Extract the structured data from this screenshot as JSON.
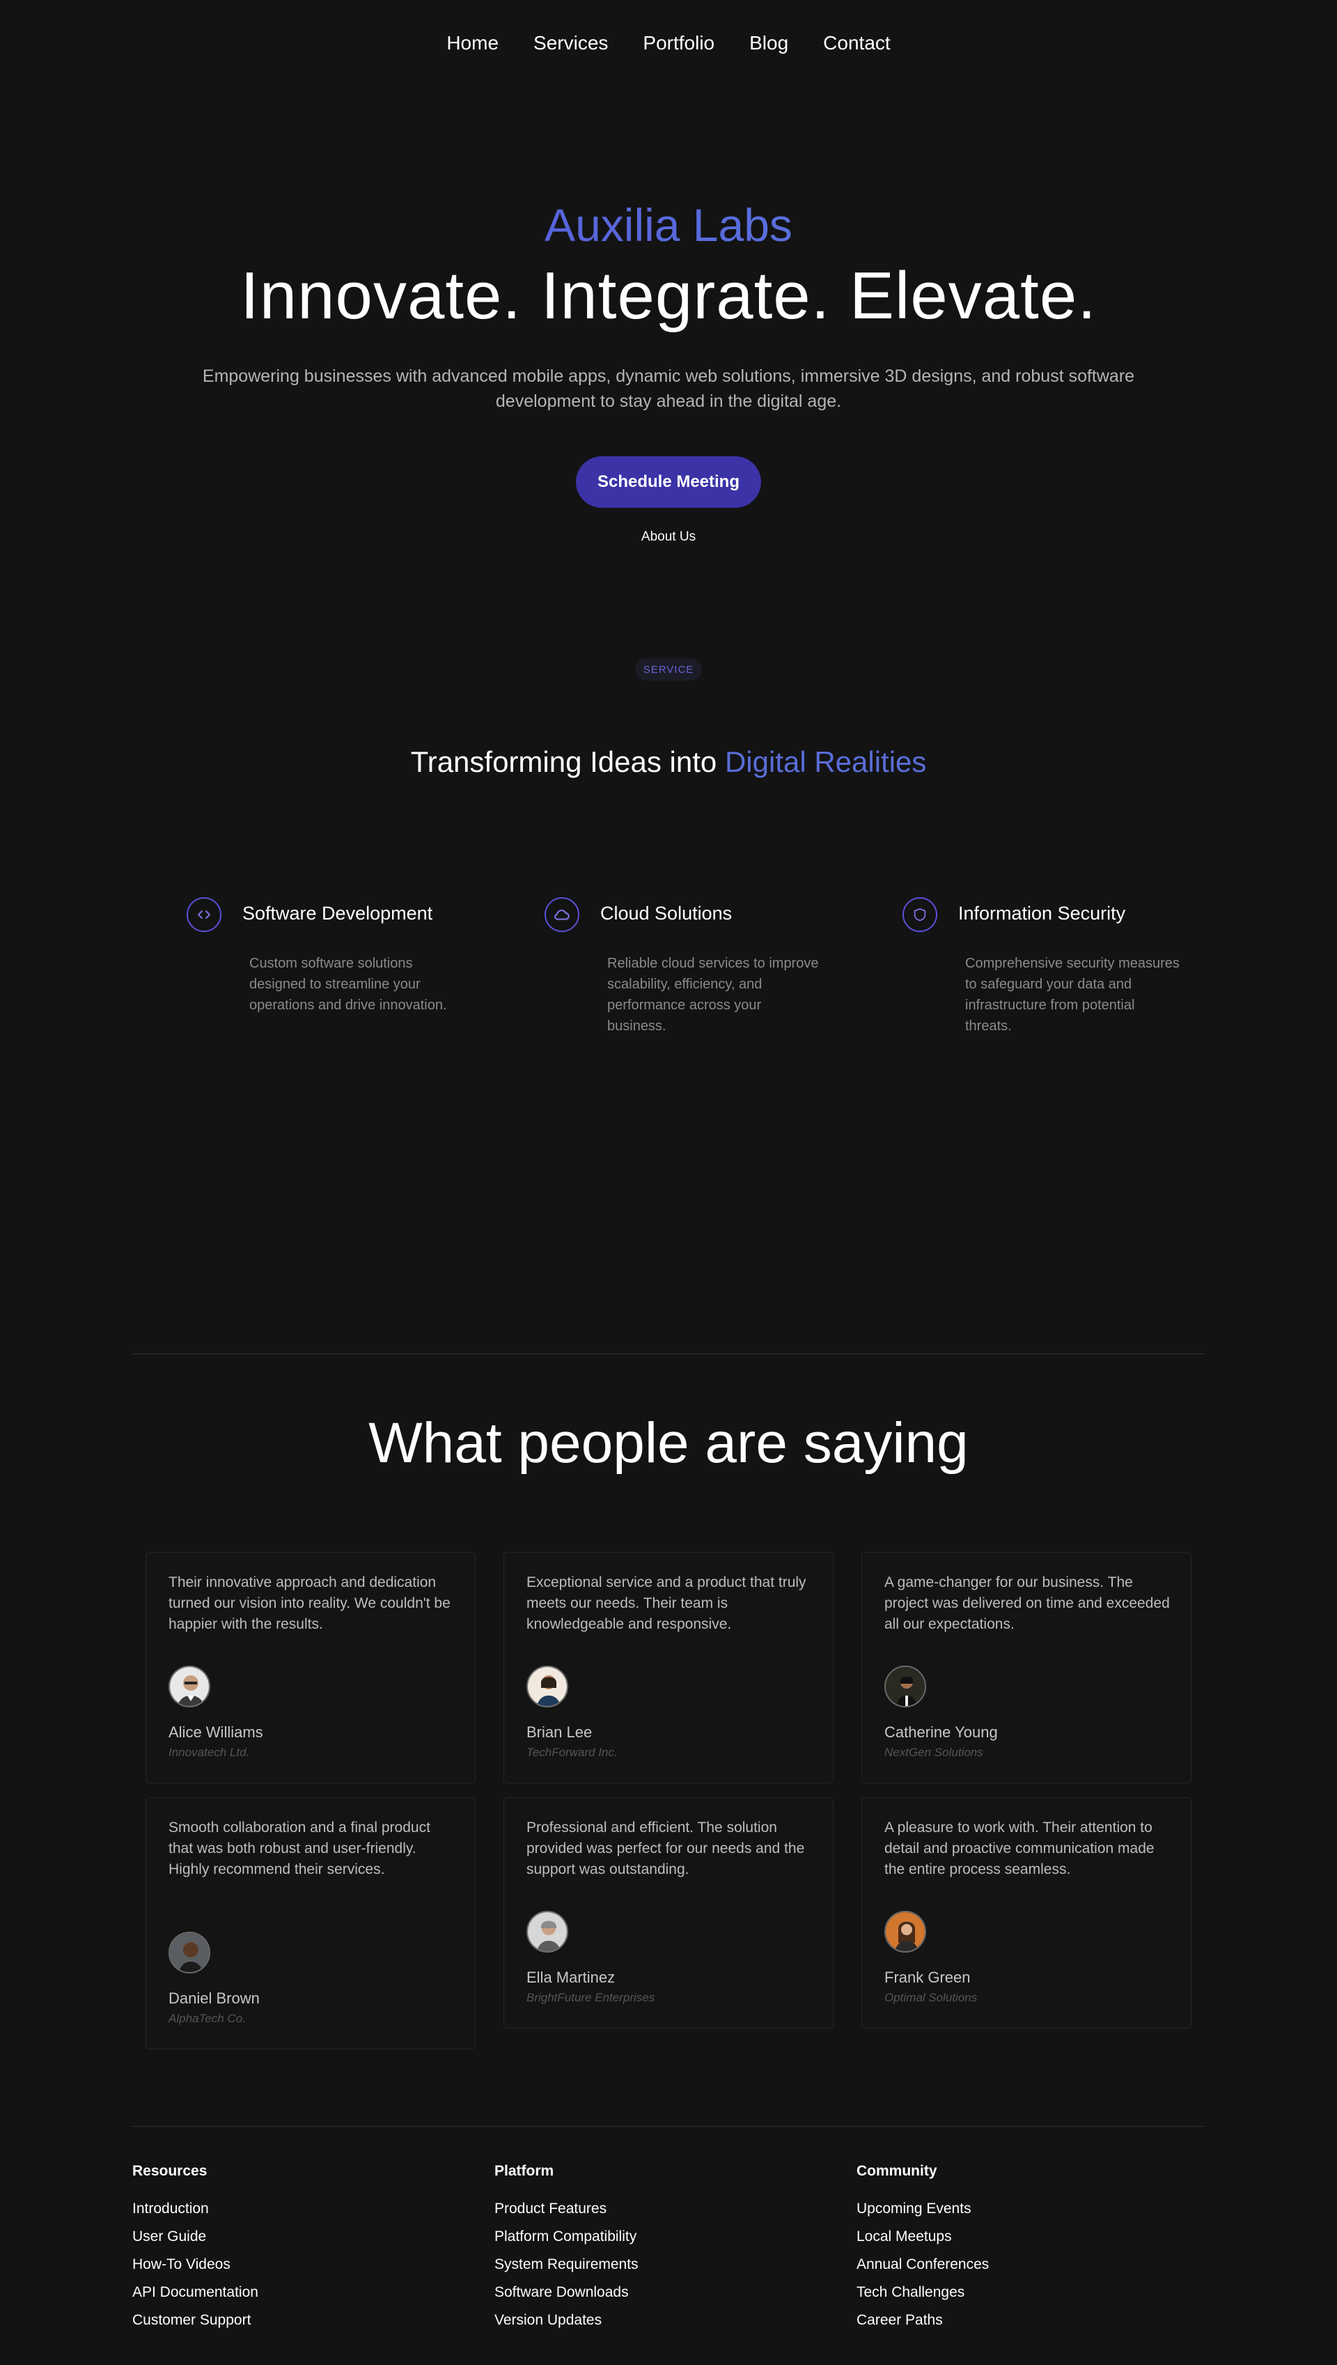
{
  "nav": {
    "items": [
      "Home",
      "Services",
      "Portfolio",
      "Blog",
      "Contact"
    ]
  },
  "hero": {
    "brand": "Auxilia Labs",
    "headline": "Innovate. Integrate. Elevate.",
    "lead": "Empowering businesses with advanced mobile apps, dynamic web solutions, immersive 3D designs, and robust software development to stay ahead in the digital age.",
    "cta": "Schedule Meeting",
    "secondary": "About Us"
  },
  "services": {
    "badge": "SERVICE",
    "title_plain": "Transforming Ideas into ",
    "title_highlight": "Digital Realities",
    "items": [
      {
        "name": "Software Development",
        "icon": "code-icon",
        "desc": "Custom software solutions designed to streamline your operations and drive innovation."
      },
      {
        "name": "Cloud Solutions",
        "icon": "cloud-icon",
        "desc": "Reliable cloud services to improve scalability, efficiency, and performance across your business."
      },
      {
        "name": "Information Security",
        "icon": "shield-icon",
        "desc": "Comprehensive security measures to safeguard your data and infrastructure from potential threats."
      }
    ]
  },
  "testimonials": {
    "title": "What people are saying",
    "items": [
      {
        "quote": "Their innovative approach and dedication turned our vision into reality. We couldn't be happier with the results.",
        "name": "Alice Williams",
        "company": "Innovatech Ltd."
      },
      {
        "quote": "Exceptional service and a product that truly meets our needs. Their team is knowledgeable and responsive.",
        "name": "Brian Lee",
        "company": "TechForward Inc."
      },
      {
        "quote": "A game-changer for our business. The project was delivered on time and exceeded all our expectations.",
        "name": "Catherine Young",
        "company": "NextGen Solutions"
      },
      {
        "quote": "Smooth collaboration and a final product that was both robust and user-friendly. Highly recommend their services.",
        "name": "Daniel Brown",
        "company": "AlphaTech Co."
      },
      {
        "quote": "Professional and efficient. The solution provided was perfect for our needs and the support was outstanding.",
        "name": "Ella Martinez",
        "company": "BrightFuture Enterprises"
      },
      {
        "quote": "A pleasure to work with. Their attention to detail and proactive communication made the entire process seamless.",
        "name": "Frank Green",
        "company": "Optimal Solutions"
      }
    ]
  },
  "footer": {
    "columns": [
      {
        "heading": "Resources",
        "links": [
          "Introduction",
          "User Guide",
          "How-To Videos",
          "API Documentation",
          "Customer Support"
        ]
      },
      {
        "heading": "Platform",
        "links": [
          "Product Features",
          "Platform Compatibility",
          "System Requirements",
          "Software Downloads",
          "Version Updates"
        ]
      },
      {
        "heading": "Community",
        "links": [
          "Upcoming Events",
          "Local Meetups",
          "Annual Conferences",
          "Tech Challenges",
          "Career Paths"
        ]
      }
    ]
  },
  "colors": {
    "background": "#131313",
    "accent": "#5a50d8",
    "cta": "#3b33a6"
  }
}
